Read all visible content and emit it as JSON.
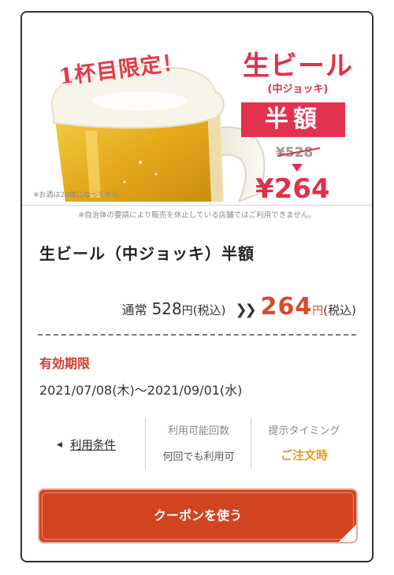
{
  "hero": {
    "tag": "1杯目限定！",
    "title": "生ビール",
    "subtitle": "(中ジョッキ)",
    "badge": "半額",
    "old_price": "¥528",
    "new_price": "¥264",
    "note_alcohol": "※お酒は20歳になってから。",
    "note_store": "※自治体の要請により販売を休止している店舗ではご利用できません。"
  },
  "coupon": {
    "title": "生ビール（中ジョッキ）半額",
    "regular_label": "通常",
    "regular_price": "528",
    "yen": "円",
    "tax": "(税込)",
    "chevrons": "❯❯",
    "sale_price": "264"
  },
  "expiry": {
    "label": "有効期限",
    "value": "2021/07/08(木)〜2021/09/01(水)"
  },
  "info": {
    "terms_link": "利用条件",
    "uses_header": "利用可能回数",
    "uses_value": "何回でも利用可",
    "timing_header": "提示タイミング",
    "timing_value": "ご注文時"
  },
  "cta": {
    "label": "クーポンを使う"
  },
  "colors": {
    "accent": "#d24420",
    "hero_red": "#e0304a",
    "timing": "#e89a1c"
  }
}
